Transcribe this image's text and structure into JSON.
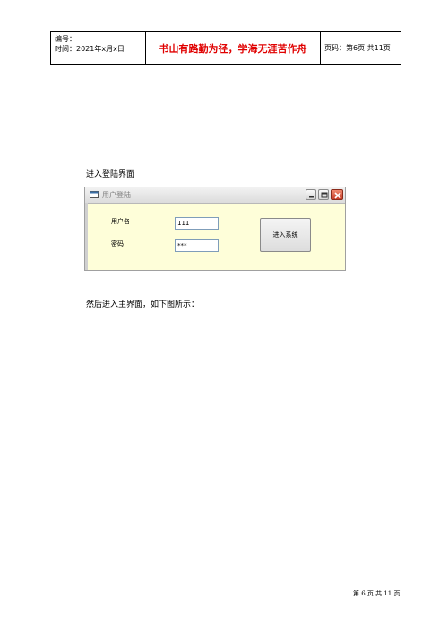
{
  "header": {
    "number_label": "编号：",
    "time_label": "时间：2021年x月x日",
    "motto": "书山有路勤为径，学海无涯苦作舟",
    "page_label": "页码：第6页 共11页"
  },
  "captions": {
    "enter_login": "进入登陆界面",
    "after_login": "然后进入主界面，如下图所示："
  },
  "dialog": {
    "title": "用户登陆",
    "username_label": "用户名",
    "password_label": "密码",
    "username_value": "111",
    "password_value": "***",
    "enter_button": "进入系统"
  },
  "footer": {
    "page": "第 6 页 共 11 页"
  }
}
